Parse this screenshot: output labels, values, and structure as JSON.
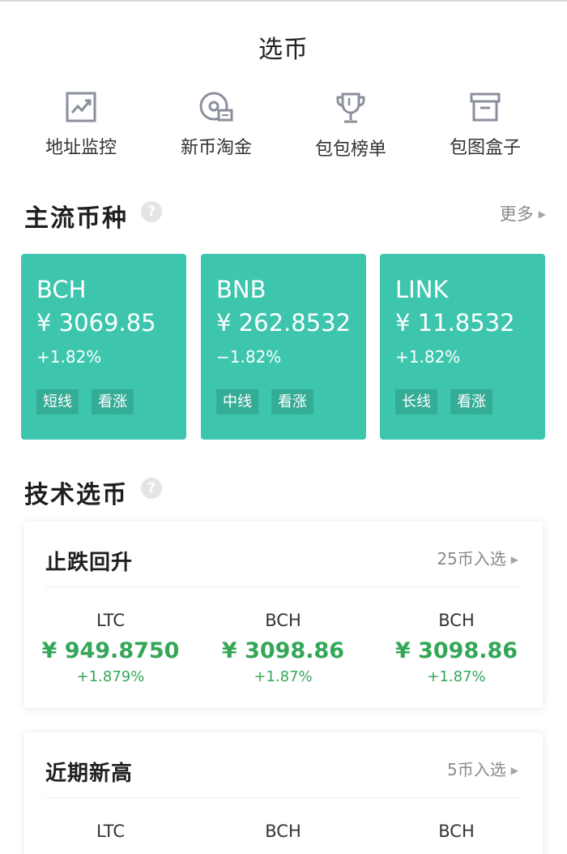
{
  "header": {
    "title": "选币"
  },
  "quick_nav": [
    {
      "label": "地址监控",
      "icon": "chart-trend-icon"
    },
    {
      "label": "新币淘金",
      "icon": "coin-search-icon"
    },
    {
      "label": "包包榜单",
      "icon": "trophy-icon"
    },
    {
      "label": "包图盒子",
      "icon": "box-icon"
    }
  ],
  "mainstream": {
    "title": "主流币种",
    "help": "?",
    "more": "更多",
    "cards": [
      {
        "name": "BCH",
        "price": "¥ 3069.85",
        "change": "+1.82%",
        "tags": [
          "短线",
          "看涨"
        ]
      },
      {
        "name": "BNB",
        "price": "¥ 262.8532",
        "change": "−1.82%",
        "tags": [
          "中线",
          "看涨"
        ]
      },
      {
        "name": "LINK",
        "price": "¥ 11.8532",
        "change": "+1.82%",
        "tags": [
          "长线",
          "看涨"
        ]
      }
    ]
  },
  "tech": {
    "title": "技术选币",
    "help": "?",
    "sections": [
      {
        "title": "止跌回升",
        "count": "25币入选",
        "coins": [
          {
            "name": "LTC",
            "price": "¥ 949.8750",
            "change": "+1.879%"
          },
          {
            "name": "BCH",
            "price": "¥ 3098.86",
            "change": "+1.87%"
          },
          {
            "name": "BCH",
            "price": "¥ 3098.86",
            "change": "+1.87%"
          }
        ]
      },
      {
        "title": "近期新高",
        "count": "5币入选",
        "coins": [
          {
            "name": "LTC"
          },
          {
            "name": "BCH"
          },
          {
            "name": "BCH"
          }
        ]
      }
    ]
  },
  "colors": {
    "card_green": "#3dc6ad",
    "price_green": "#33a757",
    "muted_text": "#8a8a8a"
  }
}
